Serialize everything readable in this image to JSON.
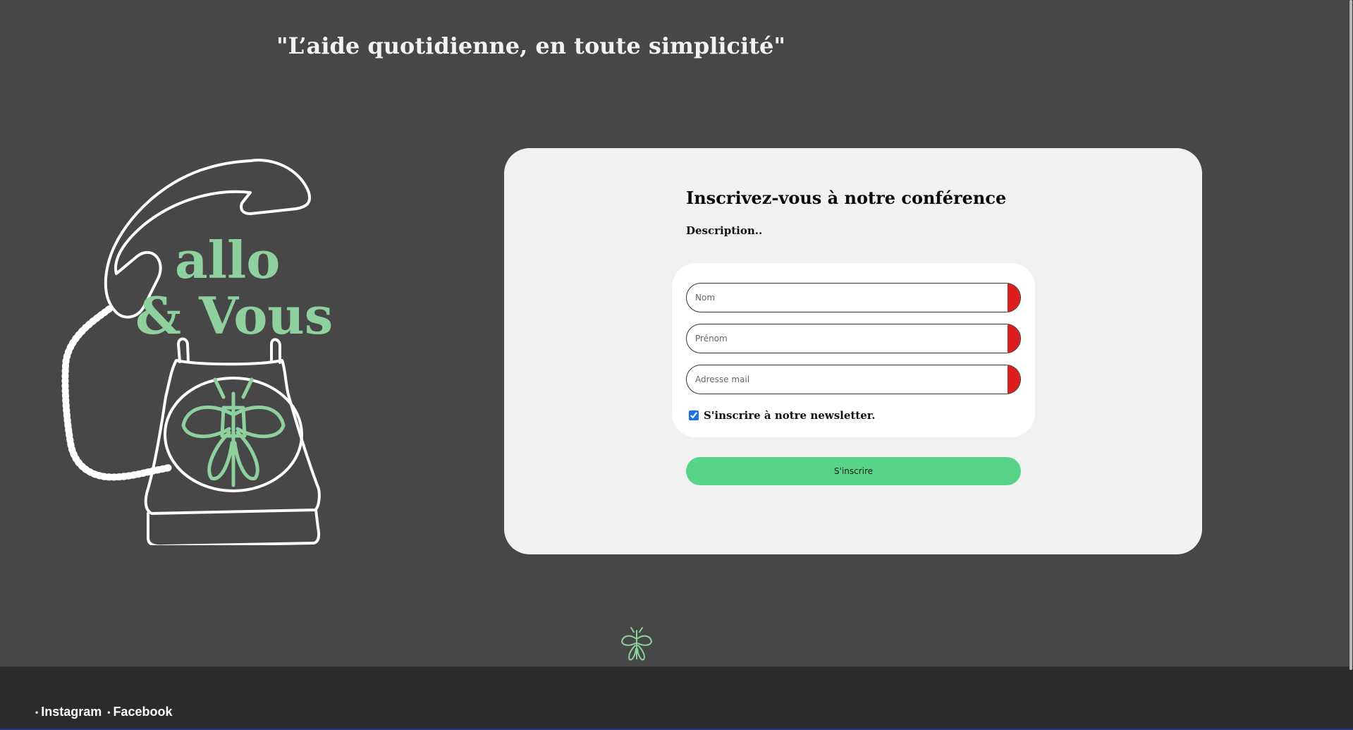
{
  "header": {
    "tagline": "\"L’aide quotidienne, en toute simplicité\""
  },
  "brand": {
    "line1": "allo",
    "line2": "& Vous"
  },
  "form": {
    "title": "Inscrivez-vous à notre conférence",
    "description": "Description..",
    "fields": [
      {
        "placeholder": "Nom",
        "value": ""
      },
      {
        "placeholder": "Prénom",
        "value": ""
      },
      {
        "placeholder": "Adresse mail",
        "value": ""
      }
    ],
    "newsletter_label": "S'inscrire à notre newsletter.",
    "newsletter_checked": true,
    "submit_label": "S'inscrire"
  },
  "footer": {
    "links": [
      {
        "label": "Instagram"
      },
      {
        "label": "Facebook"
      }
    ]
  },
  "colors": {
    "background": "#474747",
    "accent_green": "#8fd19e",
    "button_green": "#57d487",
    "required_red": "#dd1c1c",
    "footer_bg": "#292b2d"
  },
  "icons": {
    "logo": "rotary-phone-bee-logo",
    "bee": "bee-icon"
  }
}
